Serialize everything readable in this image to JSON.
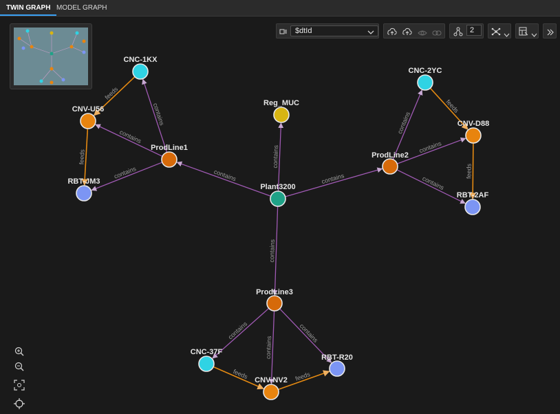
{
  "tabs": [
    {
      "label": "TWIN GRAPH",
      "active": true
    },
    {
      "label": "MODEL GRAPH",
      "active": false
    }
  ],
  "query": {
    "value": "$dtId"
  },
  "expansion_level": "2",
  "colors": {
    "cyan": "#2fd3e4",
    "orange": "#e8840f",
    "dark_orange": "#d66a0a",
    "blue": "#7c95f4",
    "yellow": "#d8b512",
    "teal": "#1fa287",
    "contains_edge": "#a05ab4",
    "feeds_edge": "#e58a12",
    "accent": "#3aa0f3"
  },
  "graph": {
    "nodes": [
      {
        "id": "Plant3200",
        "label": "Plant3200",
        "color": "teal"
      },
      {
        "id": "Reg_MUC",
        "label": "Reg_MUC",
        "color": "yellow"
      },
      {
        "id": "ProdLine1",
        "label": "ProdLine1",
        "color": "dark_orange"
      },
      {
        "id": "ProdLine2",
        "label": "ProdLine2",
        "color": "dark_orange"
      },
      {
        "id": "ProdLine3",
        "label": "ProdLine3",
        "color": "dark_orange"
      },
      {
        "id": "CNC-1KX",
        "label": "CNC-1KX",
        "color": "cyan"
      },
      {
        "id": "CNV-U56",
        "label": "CNV-U56",
        "color": "orange"
      },
      {
        "id": "RBT-JM3",
        "label": "RBT-JM3",
        "color": "blue"
      },
      {
        "id": "CNC-2YC",
        "label": "CNC-2YC",
        "color": "cyan"
      },
      {
        "id": "CNV-D88",
        "label": "CNV-D88",
        "color": "orange"
      },
      {
        "id": "RBT-2AF",
        "label": "RBT-2AF",
        "color": "blue"
      },
      {
        "id": "CNC-37F",
        "label": "CNC-37F",
        "color": "cyan"
      },
      {
        "id": "CNV-NV2",
        "label": "CNV-NV2",
        "color": "orange"
      },
      {
        "id": "RBT-R20",
        "label": "RBT-R20",
        "color": "blue"
      }
    ],
    "edges": [
      {
        "from": "Plant3200",
        "to": "ProdLine1",
        "label": "contains",
        "type": "contains"
      },
      {
        "from": "Plant3200",
        "to": "ProdLine2",
        "label": "contains",
        "type": "contains"
      },
      {
        "from": "Plant3200",
        "to": "ProdLine3",
        "label": "contains",
        "type": "contains"
      },
      {
        "from": "Plant3200",
        "to": "Reg_MUC",
        "label": "contains",
        "type": "contains"
      },
      {
        "from": "ProdLine1",
        "to": "CNC-1KX",
        "label": "contains",
        "type": "contains"
      },
      {
        "from": "ProdLine1",
        "to": "CNV-U56",
        "label": "contains",
        "type": "contains"
      },
      {
        "from": "ProdLine1",
        "to": "RBT-JM3",
        "label": "contains",
        "type": "contains"
      },
      {
        "from": "CNC-1KX",
        "to": "CNV-U56",
        "label": "feeds",
        "type": "feeds"
      },
      {
        "from": "CNV-U56",
        "to": "RBT-JM3",
        "label": "feeds",
        "type": "feeds"
      },
      {
        "from": "ProdLine2",
        "to": "CNC-2YC",
        "label": "contains",
        "type": "contains"
      },
      {
        "from": "ProdLine2",
        "to": "CNV-D88",
        "label": "contains",
        "type": "contains"
      },
      {
        "from": "ProdLine2",
        "to": "RBT-2AF",
        "label": "contains",
        "type": "contains"
      },
      {
        "from": "CNC-2YC",
        "to": "CNV-D88",
        "label": "feeds",
        "type": "feeds"
      },
      {
        "from": "CNV-D88",
        "to": "RBT-2AF",
        "label": "feeds",
        "type": "feeds"
      },
      {
        "from": "ProdLine3",
        "to": "CNC-37F",
        "label": "contains",
        "type": "contains"
      },
      {
        "from": "ProdLine3",
        "to": "CNV-NV2",
        "label": "contains",
        "type": "contains"
      },
      {
        "from": "ProdLine3",
        "to": "RBT-R20",
        "label": "contains",
        "type": "contains"
      },
      {
        "from": "CNC-37F",
        "to": "CNV-NV2",
        "label": "feeds",
        "type": "feeds"
      },
      {
        "from": "CNV-NV2",
        "to": "RBT-R20",
        "label": "feeds",
        "type": "feeds"
      }
    ]
  },
  "icons": {
    "query_icon": "query-icon",
    "select_chevron": "chevron-down-icon",
    "upload_cloud": "cloud-upload-icon",
    "upload_cloud_alt": "cloud-upload-alt-icon",
    "visibility": "eye-icon",
    "link": "link-icon",
    "expansion": "graph-expand-icon",
    "layout": "layout-icon",
    "filter": "filter-icon",
    "collapse_panel": "double-chevron-right-icon",
    "zoom_in": "zoom-in-icon",
    "zoom_out": "zoom-out-icon",
    "fit": "fit-screen-icon",
    "center": "center-icon"
  }
}
